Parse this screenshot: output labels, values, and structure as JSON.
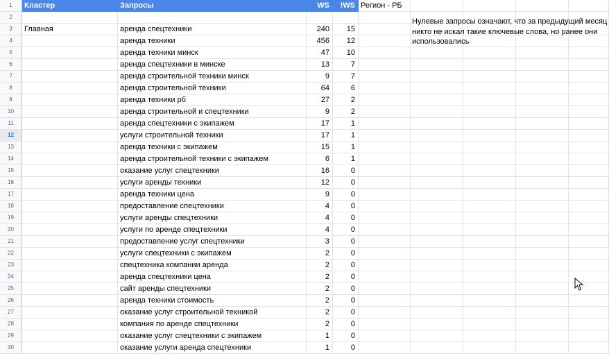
{
  "colors": {
    "header_bg": "#4a86e8",
    "header_text": "#ffffff",
    "gridline": "#e2e3e3",
    "rownum_bg": "#f8f9fa",
    "selected_row": "#1a73e8"
  },
  "header": {
    "cluster": "Кластер",
    "queries": "Запросы",
    "ws": "WS",
    "exact_ws": "!WS",
    "region": "Регион - РБ"
  },
  "note": "Нулевые запросы означают, что за предыдущий месяц никто не искал такие ключевые слова, но ранее они использовались",
  "selected_row": "12",
  "rows": [
    {
      "n": "1",
      "cluster": "",
      "query": "",
      "ws": "",
      "ews": ""
    },
    {
      "n": "2",
      "cluster": "",
      "query": "",
      "ws": "",
      "ews": ""
    },
    {
      "n": "3",
      "cluster": "Главная",
      "query": "аренда спецтехники",
      "ws": "240",
      "ews": "15"
    },
    {
      "n": "4",
      "cluster": "",
      "query": "аренда техники",
      "ws": "456",
      "ews": "12"
    },
    {
      "n": "5",
      "cluster": "",
      "query": "аренда техники минск",
      "ws": "47",
      "ews": "10"
    },
    {
      "n": "6",
      "cluster": "",
      "query": "аренда спецтехники в минске",
      "ws": "13",
      "ews": "7"
    },
    {
      "n": "7",
      "cluster": "",
      "query": "аренда строительной техники минск",
      "ws": "9",
      "ews": "7"
    },
    {
      "n": "8",
      "cluster": "",
      "query": "аренда строительной техники",
      "ws": "64",
      "ews": "6"
    },
    {
      "n": "9",
      "cluster": "",
      "query": "аренда техники рб",
      "ws": "27",
      "ews": "2"
    },
    {
      "n": "10",
      "cluster": "",
      "query": "аренда строительной и спецтехники",
      "ws": "9",
      "ews": "2"
    },
    {
      "n": "11",
      "cluster": "",
      "query": "аренда спецтехники с экипажем",
      "ws": "17",
      "ews": "1"
    },
    {
      "n": "12",
      "cluster": "",
      "query": "услуги строительной техники",
      "ws": "17",
      "ews": "1"
    },
    {
      "n": "13",
      "cluster": "",
      "query": "аренда техники с экипажем",
      "ws": "15",
      "ews": "1"
    },
    {
      "n": "14",
      "cluster": "",
      "query": "аренда строительной техники с экипажем",
      "ws": "6",
      "ews": "1"
    },
    {
      "n": "15",
      "cluster": "",
      "query": "оказание услуг спецтехники",
      "ws": "16",
      "ews": "0"
    },
    {
      "n": "16",
      "cluster": "",
      "query": "услуги аренды техники",
      "ws": "12",
      "ews": "0"
    },
    {
      "n": "17",
      "cluster": "",
      "query": "аренда техники цена",
      "ws": "9",
      "ews": "0"
    },
    {
      "n": "18",
      "cluster": "",
      "query": "предоставление спецтехники",
      "ws": "4",
      "ews": "0"
    },
    {
      "n": "19",
      "cluster": "",
      "query": "услуги аренды спецтехники",
      "ws": "4",
      "ews": "0"
    },
    {
      "n": "20",
      "cluster": "",
      "query": "услуги по аренде спецтехники",
      "ws": "4",
      "ews": "0"
    },
    {
      "n": "21",
      "cluster": "",
      "query": "предоставление услуг спецтехники",
      "ws": "3",
      "ews": "0"
    },
    {
      "n": "22",
      "cluster": "",
      "query": "услуги спецтехники с экипажем",
      "ws": "2",
      "ews": "0"
    },
    {
      "n": "23",
      "cluster": "",
      "query": "спецтехника компании аренда",
      "ws": "2",
      "ews": "0"
    },
    {
      "n": "24",
      "cluster": "",
      "query": "аренда спецтехники цена",
      "ws": "2",
      "ews": "0"
    },
    {
      "n": "25",
      "cluster": "",
      "query": "сайт аренды спецтехники",
      "ws": "2",
      "ews": "0"
    },
    {
      "n": "26",
      "cluster": "",
      "query": "аренда техники стоимость",
      "ws": "2",
      "ews": "0"
    },
    {
      "n": "27",
      "cluster": "",
      "query": "оказание услуг строительной техникой",
      "ws": "2",
      "ews": "0"
    },
    {
      "n": "28",
      "cluster": "",
      "query": "компания по аренде спецтехники",
      "ws": "2",
      "ews": "0"
    },
    {
      "n": "29",
      "cluster": "",
      "query": "оказание услуг спецтехники с экипажем",
      "ws": "1",
      "ews": "0"
    },
    {
      "n": "30",
      "cluster": "",
      "query": "оказание услуги аренда спецтехники",
      "ws": "1",
      "ews": "0"
    }
  ]
}
